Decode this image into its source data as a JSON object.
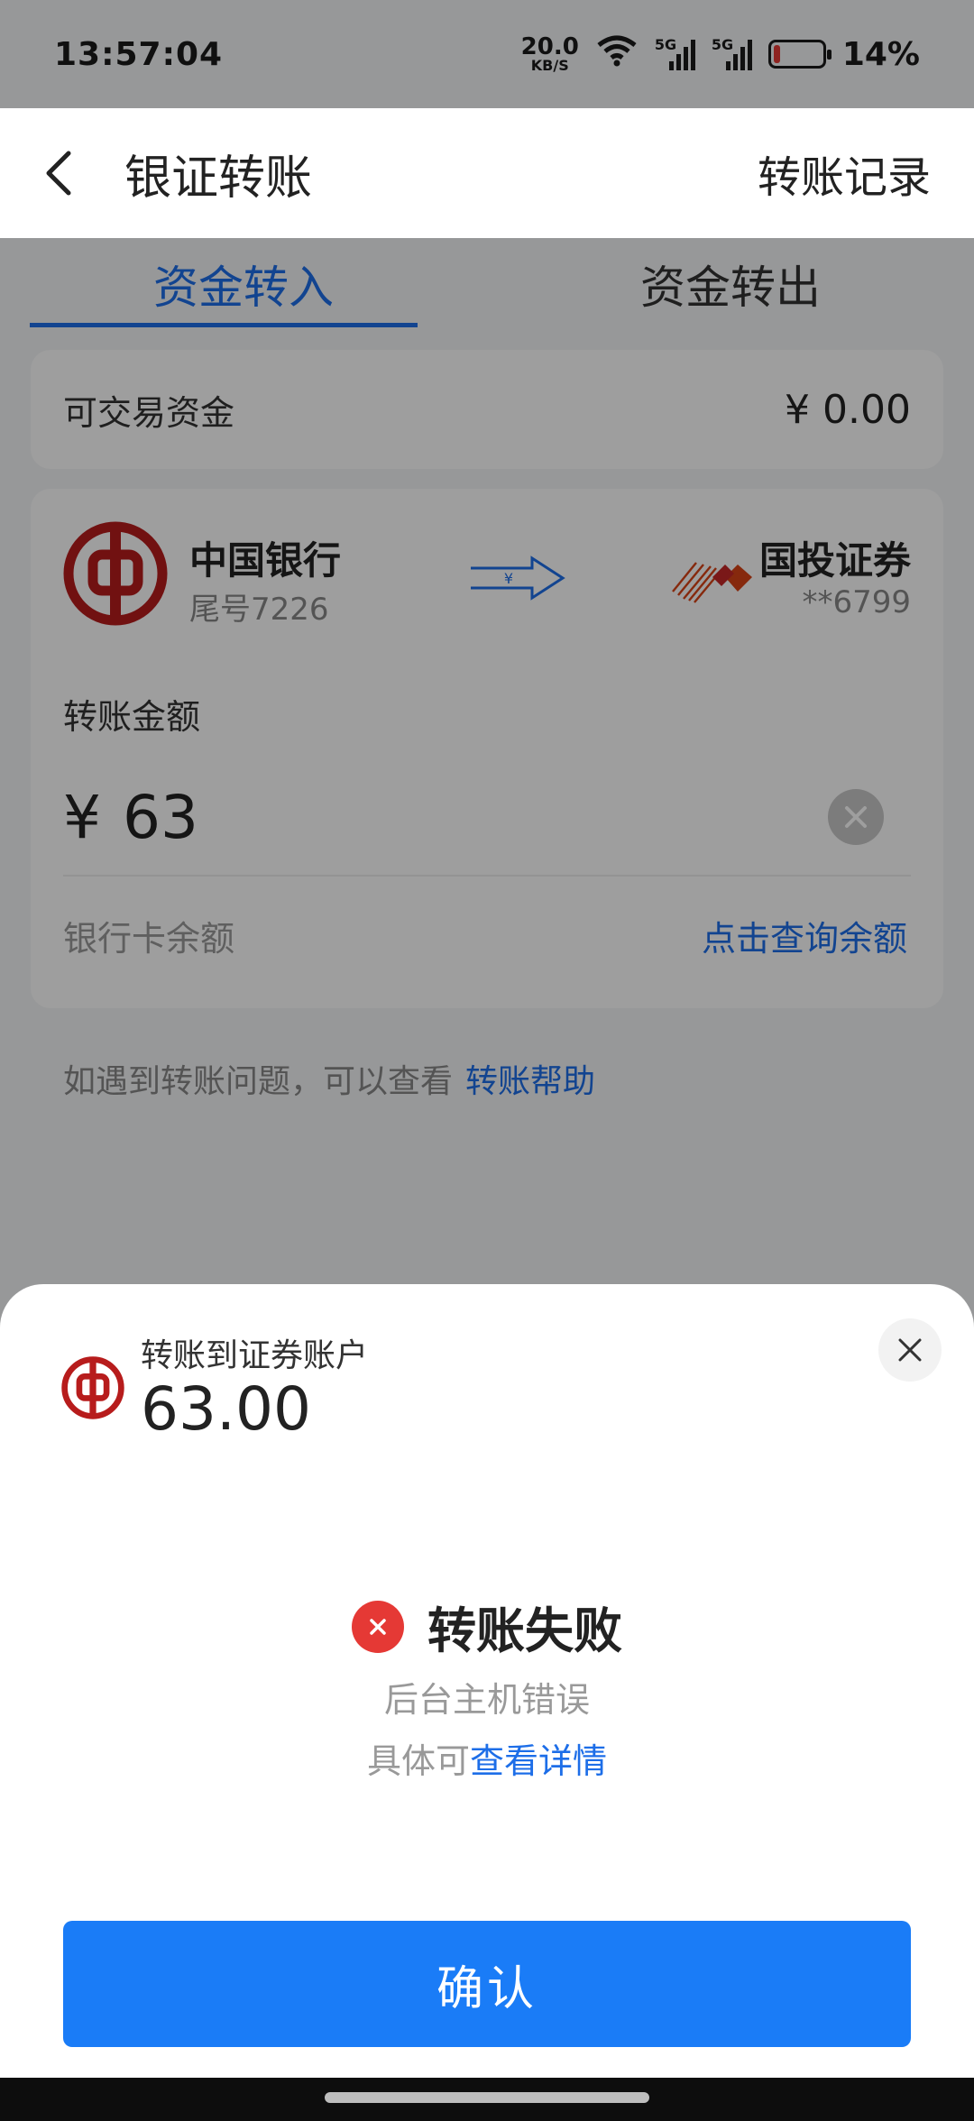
{
  "status": {
    "time": "13:57:04",
    "net_speed_value": "20.0",
    "net_speed_unit": "KB/S",
    "sig_label_1": "5G",
    "sig_label_2": "5G",
    "battery": "14%",
    "battery_level": 0.14
  },
  "header": {
    "title": "银证转账",
    "record": "转账记录"
  },
  "tabs": [
    {
      "label": "资金转入",
      "active": true
    },
    {
      "label": "资金转出",
      "active": false
    }
  ],
  "fund": {
    "label": "可交易资金",
    "value": "¥ 0.00"
  },
  "transfer": {
    "bank_name": "中国银行",
    "bank_tail": "尾号7226",
    "arrow_symbol": "¥",
    "securities_name": "国投证券",
    "securities_tail": "**6799",
    "amount_label": "转账金额",
    "currency": "¥",
    "amount": "63",
    "balance_label": "银行卡余额",
    "balance_link": "点击查询余额"
  },
  "help": {
    "text": "如遇到转账问题，可以查看",
    "link": "转账帮助"
  },
  "sheet": {
    "subtitle": "转账到证券账户",
    "amount": "63.00",
    "status": "转账失败",
    "reason": "后台主机错误",
    "detail_prefix": "具体可",
    "detail_link": "查看详情",
    "confirm": "确认"
  },
  "colors": {
    "accent": "#1d6ee8",
    "button": "#1a7cf7",
    "error": "#e53935",
    "boc_red": "#b71c1c"
  }
}
